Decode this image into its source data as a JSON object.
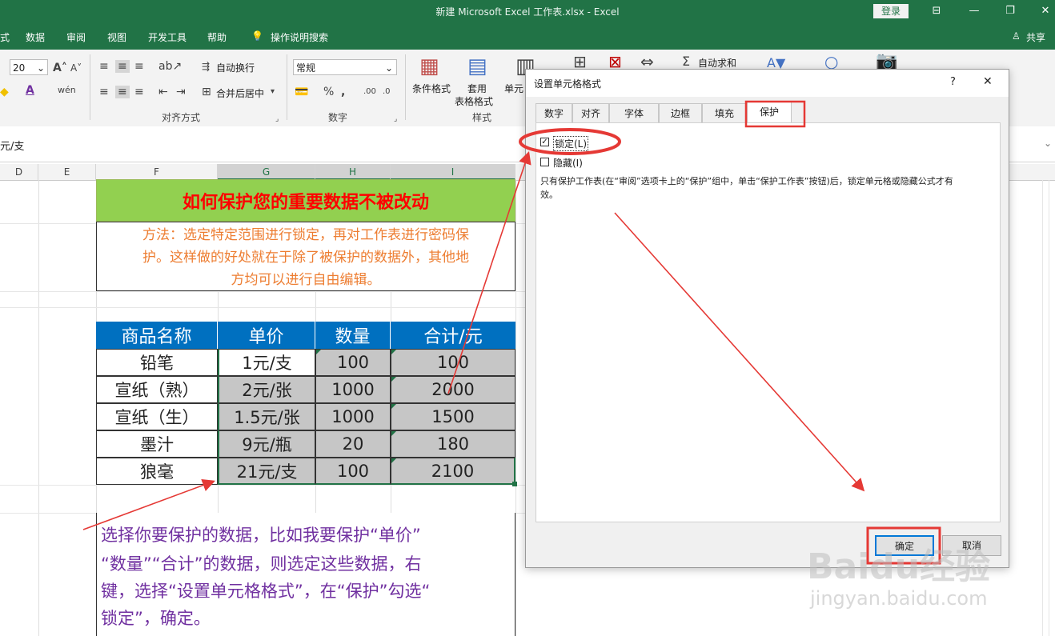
{
  "window": {
    "title": "新建 Microsoft Excel 工作表.xlsx  -  Excel",
    "login": "登录"
  },
  "ribbon_tabs": [
    "式",
    "数据",
    "审阅",
    "视图",
    "开发工具",
    "帮助",
    "操作说明搜索",
    "共享"
  ],
  "ribbon": {
    "font_size": "20",
    "wrap_text": "自动换行",
    "merge_center": "合并后居中",
    "align_group": "对齐方式",
    "number_format": "常规",
    "number_group": "数字",
    "cond_format": "条件格式",
    "table_format_1": "套用",
    "table_format_2": "表格格式",
    "cell_style": "单元",
    "style_group": "样式",
    "autosum": "自动求和"
  },
  "formula_bar": {
    "content": "元/支"
  },
  "columns": [
    "D",
    "E",
    "F",
    "G",
    "H",
    "I"
  ],
  "sheet": {
    "title": "如何保护您的重要数据不被改动",
    "method_line1": "方法：选定特定范围进行锁定，再对工作表进行密码保",
    "method_line2": "护。这样做的好处就在于除了被保护的数据外，其他地",
    "method_line3": "方均可以进行自由编辑。",
    "headers": [
      "商品名称",
      "单价",
      "数量",
      "合计/元"
    ],
    "rows": [
      [
        "铅笔",
        "1元/支",
        "100",
        "100"
      ],
      [
        "宣纸（熟）",
        "2元/张",
        "1000",
        "2000"
      ],
      [
        "宣纸（生）",
        "1.5元/张",
        "1000",
        "1500"
      ],
      [
        "墨汁",
        "9元/瓶",
        "20",
        "180"
      ],
      [
        "狼毫",
        "21元/支",
        "100",
        "2100"
      ]
    ],
    "callout_lines": [
      "选择你要保护的数据，比如我要保护“单价”",
      "“数量”“合计”的数据，则选定这些数据，右",
      "键，选择“设置单元格格式”，在“保护”勾选“",
      "锁定”，确定。"
    ]
  },
  "dialog": {
    "title": "设置单元格格式",
    "help": "?",
    "close": "✕",
    "tabs": [
      "数字",
      "对齐",
      "字体",
      "边框",
      "填充",
      "保护"
    ],
    "active_tab": "保护",
    "locked_label": "锁定(L)",
    "locked_checked": true,
    "hidden_label": "隐藏(I)",
    "hidden_checked": false,
    "description_line1": "只有保护工作表(在“审阅”选项卡上的“保护”组中，单击“保护工作表”按钮)后，锁定单元格或隐藏公式才有",
    "description_line2": "效。",
    "ok": "确定",
    "cancel": "取消"
  },
  "watermark": {
    "brand": "Baidu经验",
    "url": "jingyan.baidu.com"
  },
  "colors": {
    "excel_green": "#217346",
    "annotation_red": "#e53935",
    "title_red": "#ff0000",
    "title_bg": "#92d050",
    "header_blue": "#0070c0",
    "method_orange": "#ed7d31",
    "callout_purple": "#7030a0"
  }
}
